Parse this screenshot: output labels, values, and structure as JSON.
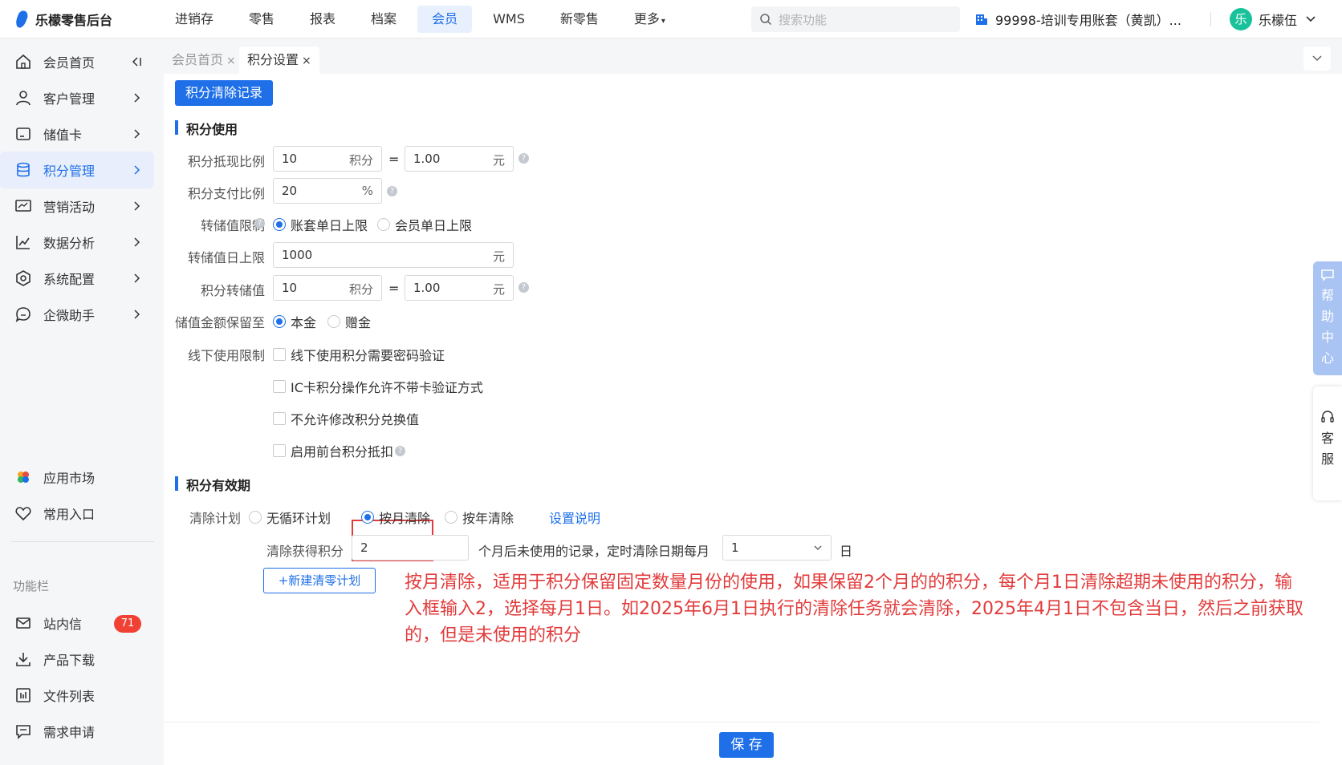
{
  "app": {
    "title": "乐檬零售后台"
  },
  "nav": {
    "items": [
      "进销存",
      "零售",
      "报表",
      "档案",
      "会员",
      "WMS",
      "新零售",
      "更多"
    ],
    "active_index": 4
  },
  "search": {
    "placeholder": "搜索功能"
  },
  "account": {
    "label": "99998-培训专用账套（黄凯）..."
  },
  "user": {
    "avatar_char": "乐",
    "name": "乐檬伍"
  },
  "sidebar": {
    "items": [
      {
        "label": "会员首页",
        "icon": "home-icon"
      },
      {
        "label": "客户管理",
        "icon": "user-icon"
      },
      {
        "label": "储值卡",
        "icon": "card-icon"
      },
      {
        "label": "积分管理",
        "icon": "database-icon"
      },
      {
        "label": "营销活动",
        "icon": "monitor-icon"
      },
      {
        "label": "数据分析",
        "icon": "chart-line-icon"
      },
      {
        "label": "系统配置",
        "icon": "settings-icon"
      },
      {
        "label": "企微助手",
        "icon": "chat-icon"
      }
    ],
    "bottom": [
      {
        "label": "应用市场",
        "icon": "app-market-icon"
      },
      {
        "label": "常用入口",
        "icon": "heart-icon"
      }
    ],
    "section_label": "功能栏",
    "tools": [
      {
        "label": "站内信",
        "icon": "mail-icon",
        "badge": "71"
      },
      {
        "label": "产品下载",
        "icon": "download-icon"
      },
      {
        "label": "文件列表",
        "icon": "file-list-icon"
      },
      {
        "label": "需求申请",
        "icon": "request-icon"
      }
    ]
  },
  "tabs": [
    {
      "label": "会员首页",
      "active": false
    },
    {
      "label": "积分设置",
      "active": true
    }
  ],
  "main": {
    "clear_records_button": "积分清除记录",
    "usage": {
      "title": "积分使用",
      "cash_ratio": {
        "label": "积分抵现比例",
        "points": "10",
        "points_unit": "积分",
        "eq": "=",
        "yuan": "1.00",
        "yuan_unit": "元"
      },
      "pay_ratio": {
        "label": "积分支付比例",
        "value": "20",
        "unit": "%"
      },
      "stored_limit": {
        "label": "转储值限制",
        "options": [
          "账套单日上限",
          "会员单日上限"
        ],
        "selected": 0
      },
      "stored_daily_cap": {
        "label": "转储值日上限",
        "value": "1000",
        "unit": "元"
      },
      "points_to_stored": {
        "label": "积分转储值",
        "points": "10",
        "points_unit": "积分",
        "eq": "=",
        "yuan": "1.00",
        "yuan_unit": "元"
      },
      "stored_keep": {
        "label": "储值金额保留至",
        "options": [
          "本金",
          "赠金"
        ],
        "selected": 0
      },
      "offline_limit": {
        "label": "线下使用限制",
        "options": [
          "线下使用积分需要密码验证",
          "IC卡积分操作允许不带卡验证方式",
          "不允许修改积分兑换值",
          "启用前台积分抵扣"
        ]
      }
    },
    "validity": {
      "title": "积分有效期",
      "plan": {
        "label": "清除计划",
        "options": [
          "无循环计划",
          "按月清除",
          "按年清除"
        ],
        "selected": 1,
        "help_link": "设置说明"
      },
      "clear_rule": {
        "label": "清除获得积分",
        "months": "2",
        "middle_text": "个月后未使用的记录，定时清除日期每月",
        "day": "1",
        "day_unit": "日"
      },
      "new_plan_button": "+新建清零计划"
    },
    "annotation": "按月清除，适用于积分保留固定数量月份的使用，如果保留2个月的的积分，每个月1日清除超期未使用的积分，输入框输入2，选择每月1日。如2025年6月1日执行的清除任务就会清除，2025年4月1日不包含当日，然后之前获取的，但是未使用的积分"
  },
  "footer": {
    "save_button": "保 存"
  },
  "floating": {
    "help_center": [
      "帮",
      "助",
      "中",
      "心"
    ],
    "customer_service": [
      "客",
      "服"
    ]
  },
  "colors": {
    "primary": "#1e6fe8",
    "annotation_red": "#e23b3b",
    "badge_red": "#f04134"
  }
}
